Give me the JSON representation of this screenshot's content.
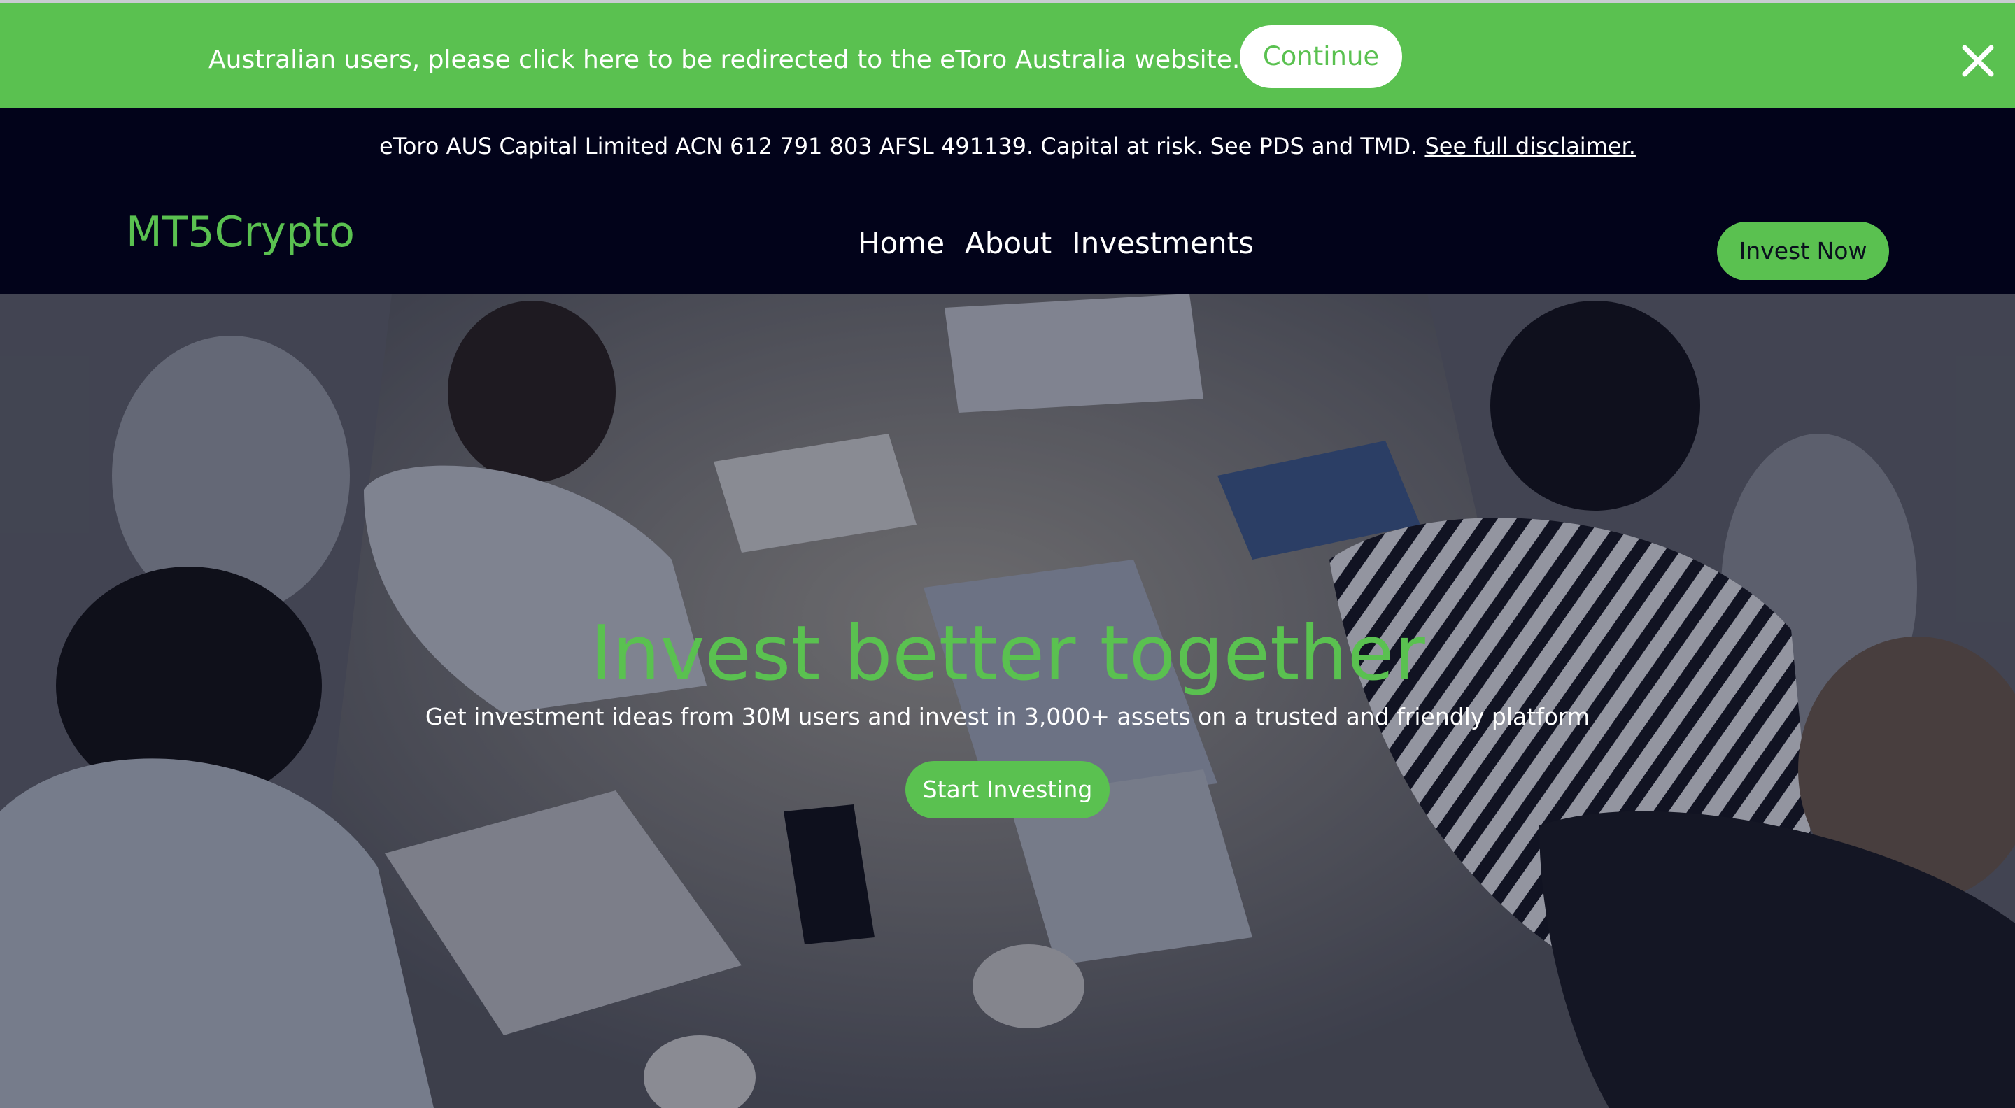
{
  "geo_banner": {
    "message": "Australian users, please click here to be redirected to the eToro Australia website.",
    "continue_label": "Continue",
    "close_icon": "close-icon"
  },
  "disclaimer": {
    "text": "eToro AUS Capital Limited ACN 612 791 803 AFSL 491139. Capital at risk. See PDS and TMD. ",
    "link_label": "See full disclaimer."
  },
  "navbar": {
    "logo": "MT5Crypto",
    "links": [
      "Home",
      "About",
      "Investments"
    ],
    "cta_label": "Invest Now"
  },
  "hero": {
    "title": "Invest better together",
    "subtitle": "Get investment ideas from 30M users and invest in 3,000+ assets on a trusted and friendly platform",
    "cta_label": "Start Investing"
  },
  "colors": {
    "accent_green": "#5ac150",
    "dark_navy": "#02031a",
    "white": "#ffffff"
  }
}
